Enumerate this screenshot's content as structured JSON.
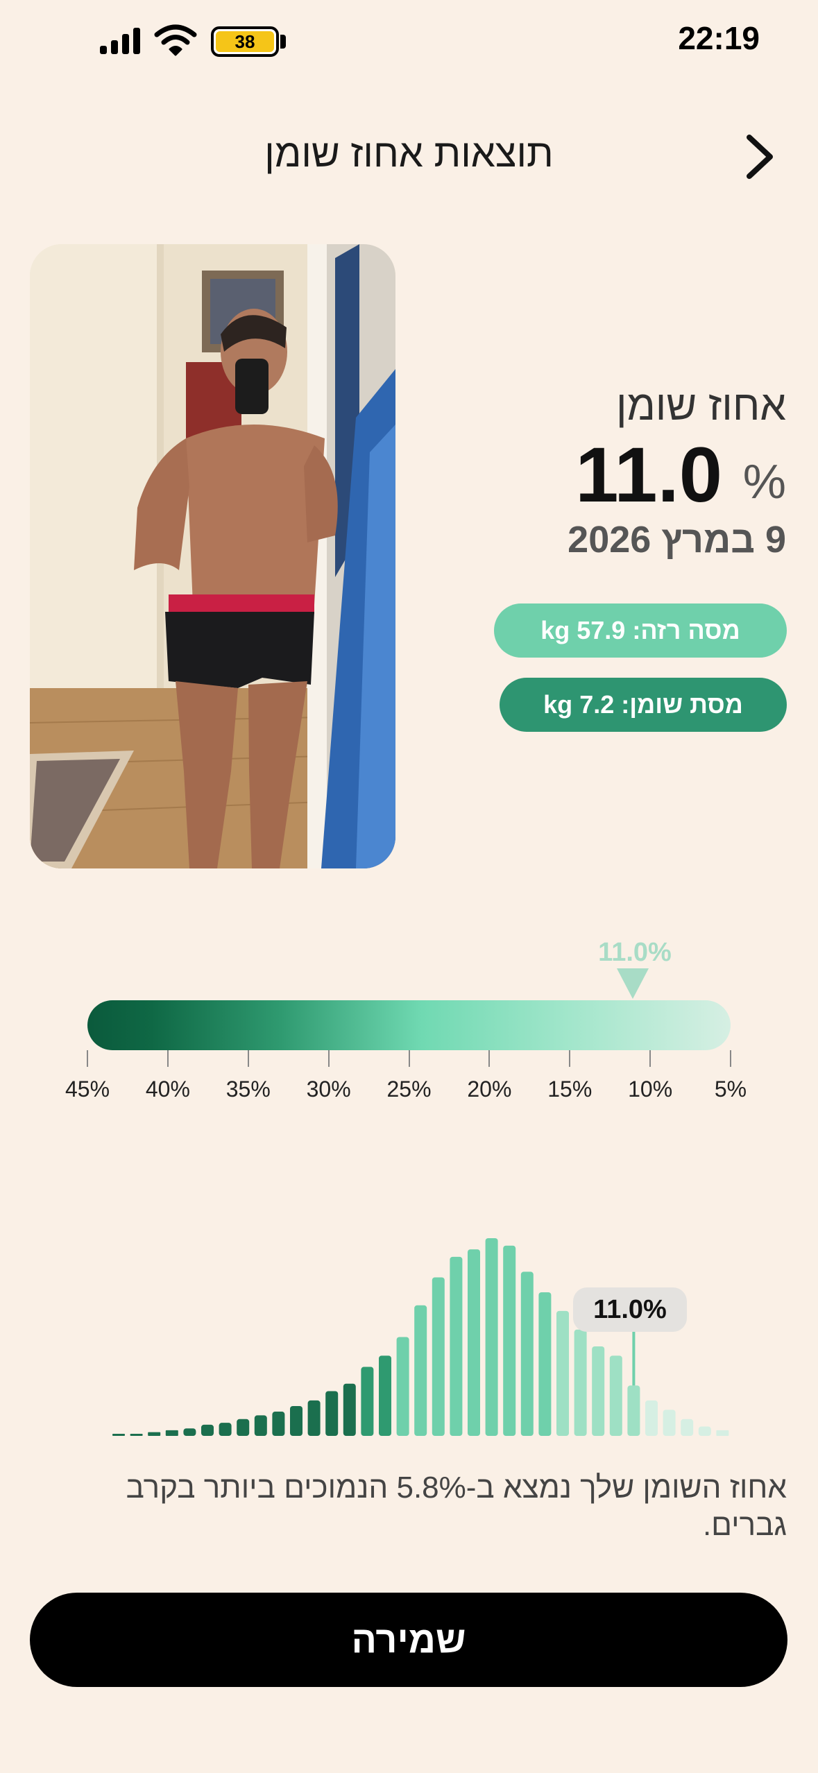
{
  "status_bar": {
    "time": "22:19",
    "battery": "38"
  },
  "header": {
    "title": "תוצאות אחוז שומן"
  },
  "stats": {
    "label": "אחוז שומן",
    "value": "11.0",
    "unit": "%",
    "date": "9 במרץ 2026"
  },
  "pills": {
    "lean_mass": "מסה רזה: 57.9 kg",
    "fat_mass": "מסת שומן: 7.2 kg"
  },
  "scale": {
    "marker_label": "11.0%",
    "marker_value": 11.0,
    "ticks": [
      "45%",
      "40%",
      "35%",
      "30%",
      "25%",
      "20%",
      "15%",
      "10%",
      "5%"
    ]
  },
  "distribution": {
    "callout": "11.0%",
    "highlight_value": 11.0,
    "bar_heights": [
      1,
      1,
      2,
      3,
      4,
      6,
      7,
      9,
      11,
      13,
      16,
      19,
      24,
      28,
      37,
      43,
      53,
      70,
      85,
      96,
      100,
      106,
      102,
      88,
      77,
      67,
      57,
      48,
      43,
      27,
      19,
      14,
      9,
      5,
      3
    ]
  },
  "summary": "אחוז השומן שלך נמצא ב-5.8% הנמוכים ביותר בקרב גברים.",
  "save_button": "שמירה",
  "colors": {
    "background": "#faf0e6",
    "dark_green": "#0b5a3c",
    "mid_green": "#6fd0ab",
    "light_green": "#d6efe3"
  }
}
